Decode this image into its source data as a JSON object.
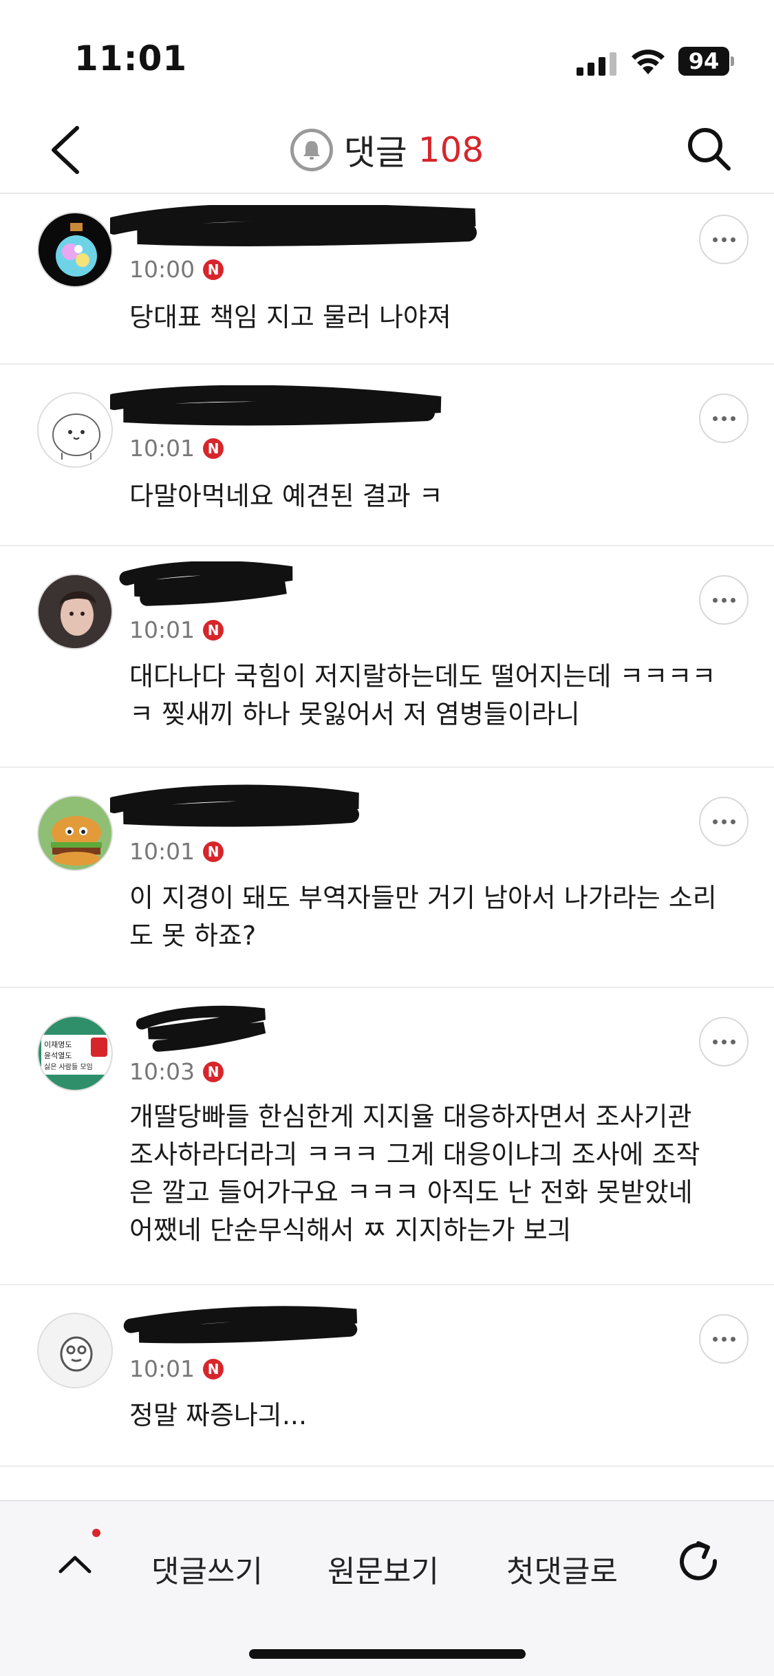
{
  "status_bar": {
    "time": "11:01",
    "battery": "94",
    "icons": [
      "cellular-signal-icon",
      "wifi-icon",
      "battery-icon"
    ]
  },
  "nav": {
    "back_icon": "chevron-left-icon",
    "bell_icon": "bell-icon",
    "title": "댓글",
    "count": "108",
    "search_icon": "search-icon",
    "accent_color": "#d6262c"
  },
  "comments": [
    {
      "time": "10:00",
      "badge": "N",
      "text": "당대표 책임 지고 물러 나야져"
    },
    {
      "time": "10:01",
      "badge": "N",
      "text": "다말아먹네요 예견된 결과 ㅋ"
    },
    {
      "time": "10:01",
      "badge": "N",
      "text": "대다나다 국힘이 저지랄하는데도 떨어지는데 ㅋㅋㅋㅋ\nㅋ 찢새끼 하나 못잃어서 저 염병들이라니"
    },
    {
      "time": "10:01",
      "badge": "N",
      "text": "이 지경이 돼도 부역자들만 거기 남아서 나가라는 소리\n도 못 하죠?"
    },
    {
      "time": "10:03",
      "badge": "N",
      "text": "개딸당빠들 한심한게 지지율 대응하자면서 조사기관\n조사하라더라긔 ㅋㅋㅋ 그게 대응이냐긔 조사에 조작\n은 깔고 들어가구요 ㅋㅋㅋ  아직도 난 전화 못받았네\n어쨌네 단순무식해서 ㅉ 지지하는가 보긔"
    },
    {
      "time": "10:01",
      "badge": "N",
      "text": "정말 짜증나긔..."
    }
  ],
  "avatar_badge": {
    "line1": "이재명도",
    "line2": "윤석열도",
    "line3": "싫은 사람들 모임"
  },
  "toolbar": {
    "up_icon": "chevron-up-icon",
    "write": "댓글쓰기",
    "original": "원문보기",
    "first": "첫댓글로",
    "refresh_icon": "refresh-icon"
  }
}
